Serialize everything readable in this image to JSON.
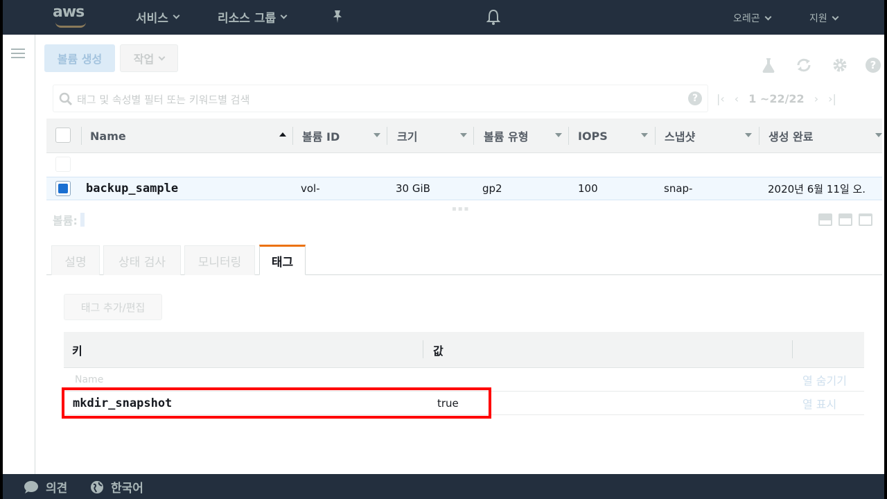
{
  "topnav": {
    "logo_text": "aws",
    "services_label": "서비스",
    "resource_groups_label": "리소스 그룹",
    "region_label": "오레곤",
    "support_label": "지원"
  },
  "toolbar": {
    "create_volume_label": "볼륨 생성",
    "actions_label": "작업"
  },
  "search": {
    "placeholder": "태그 및 속성별 필터 또는 키워드별 검색",
    "help_label": "?"
  },
  "pager": {
    "text": "1 ~22/22"
  },
  "volumes_table": {
    "columns": [
      "Name",
      "볼륨 ID",
      "크기",
      "볼륨 유형",
      "IOPS",
      "스냅샷",
      "생성 완료"
    ],
    "rows": [
      {
        "name": "backup_sample",
        "volume_id": "vol-",
        "size": "30 GiB",
        "type": "gp2",
        "iops": "100",
        "snapshot": "snap-",
        "created": "2020년 6월 11일 오."
      }
    ]
  },
  "detail": {
    "title": "볼륨:",
    "tabs": [
      "설명",
      "상태 검사",
      "모니터링",
      "태그"
    ],
    "active_tab": "태그",
    "edit_tags_label": "태그 추가/편집"
  },
  "tags_table": {
    "columns": [
      "키",
      "값"
    ],
    "rows": [
      {
        "key": "Name",
        "value": "",
        "action": "열 숨기기",
        "faded": true
      },
      {
        "key": "mkdir_snapshot",
        "value": "true",
        "action": "열 표시",
        "faded": false
      }
    ]
  },
  "footer": {
    "feedback_label": "의견",
    "language_label": "한국어"
  },
  "colors": {
    "nav_bg": "#232f3e",
    "accent_tab": "#ec7211",
    "highlight": "#ff0000",
    "selected_row": "#f1f8fe"
  }
}
